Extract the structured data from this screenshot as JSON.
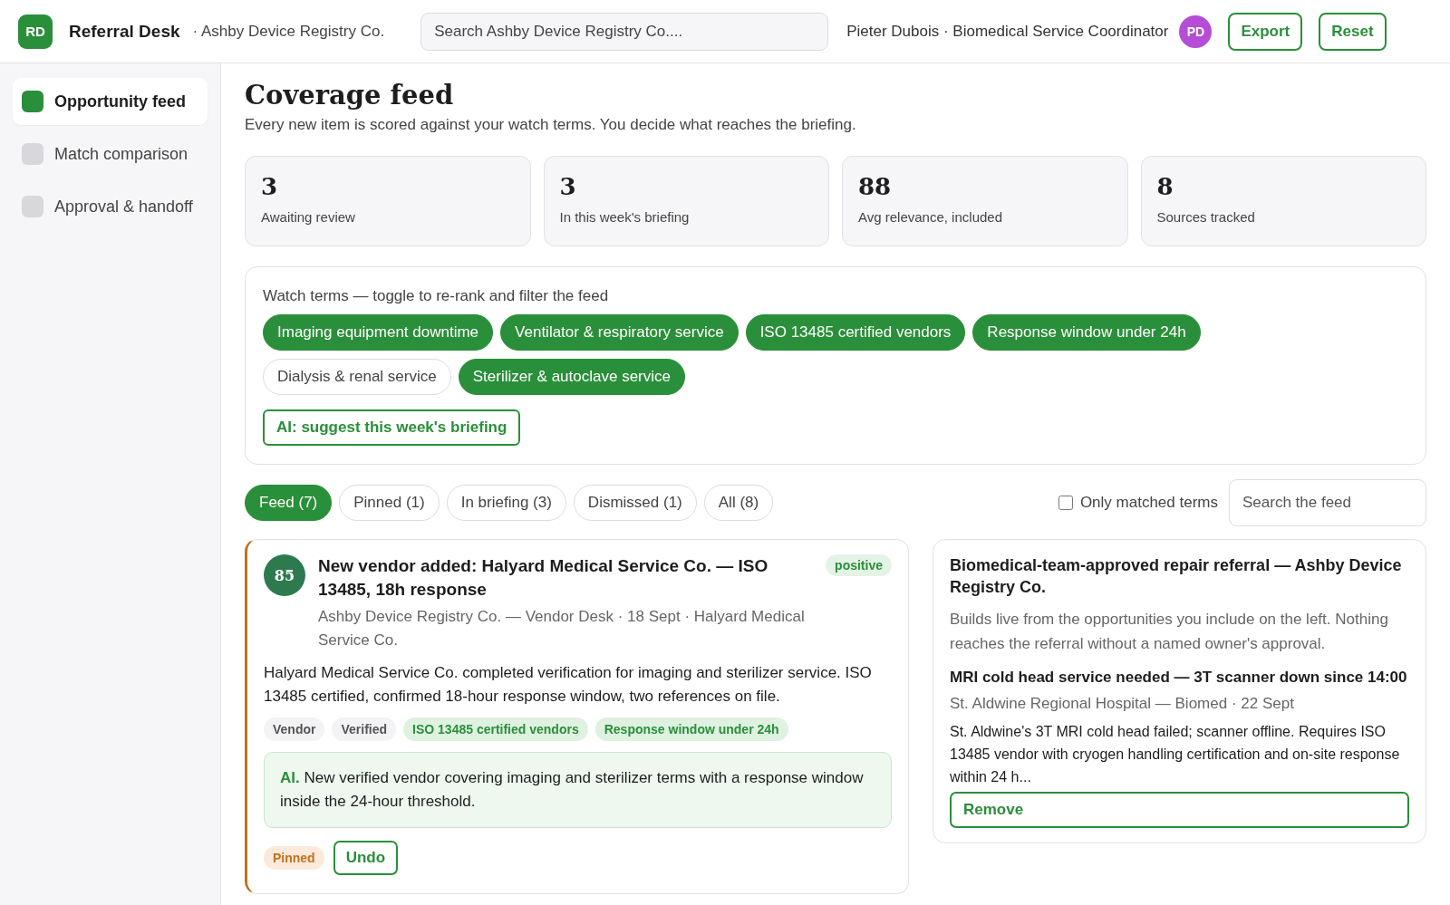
{
  "header": {
    "logo": "RD",
    "app_name": "Referral Desk",
    "org": "· Ashby Device Registry Co.",
    "search": {
      "placeholder": "Search Ashby Device Registry Co...."
    },
    "user": "Pieter Dubois · Biomedical Service Coordinator",
    "avatar": "PD",
    "buttons": [
      "Export",
      "Reset"
    ]
  },
  "sidebar": {
    "items": [
      {
        "label": "Opportunity feed",
        "selected": true
      },
      {
        "label": "Match comparison",
        "selected": false
      },
      {
        "label": "Approval & handoff",
        "selected": false
      }
    ]
  },
  "page": {
    "title": "Coverage feed",
    "subtitle": "Every new item is scored against your watch terms. You decide what reaches the briefing."
  },
  "stats": [
    {
      "value": "3",
      "label": "Awaiting review"
    },
    {
      "value": "3",
      "label": "In this week's briefing"
    },
    {
      "value": "88",
      "label": "Avg relevance, included"
    },
    {
      "value": "8",
      "label": "Sources tracked"
    }
  ],
  "watch_terms": {
    "label": "Watch terms — toggle to re-rank and filter the feed",
    "terms": [
      {
        "label": "Imaging equipment downtime",
        "on": true
      },
      {
        "label": "Ventilator & respiratory service",
        "on": true
      },
      {
        "label": "ISO 13485 certified vendors",
        "on": true
      },
      {
        "label": "Response window under 24h",
        "on": true
      },
      {
        "label": "Dialysis & renal service",
        "on": false
      },
      {
        "label": "Sterilizer & autoclave service",
        "on": true
      }
    ],
    "ai_button": "AI: suggest this week's briefing"
  },
  "filters": {
    "tabs": [
      {
        "label": "Feed (7)",
        "selected": true
      },
      {
        "label": "Pinned (1)",
        "selected": false
      },
      {
        "label": "In briefing (3)",
        "selected": false
      },
      {
        "label": "Dismissed (1)",
        "selected": false
      },
      {
        "label": "All (8)",
        "selected": false
      }
    ],
    "only_matched": {
      "label": "Only matched terms",
      "checked": false
    },
    "search": {
      "placeholder": "Search the feed"
    }
  },
  "feed": [
    {
      "score": "85",
      "title": "New vendor added: Halyard Medical Service Co. — ISO 13485, 18h response",
      "sentiment": "positive",
      "meta": "Ashby Device Registry Co. — Vendor Desk · 18 Sept · Halyard Medical Service Co.",
      "body": "Halyard Medical Service Co. completed verification for imaging and sterilizer service. ISO 13485 certified, confirmed 18-hour response window, two references on file.",
      "tags": [
        {
          "label": "Vendor",
          "kind": "plain"
        },
        {
          "label": "Verified",
          "kind": "plain"
        },
        {
          "label": "ISO 13485 certified vendors",
          "kind": "term"
        },
        {
          "label": "Response window under 24h",
          "kind": "term"
        }
      ],
      "ai_note": "**AI.** New verified vendor covering imaging and sterilizer terms with a response window inside the 24-hour threshold.",
      "pinned": true,
      "status": "Pinned",
      "action": "Undo"
    }
  ],
  "referral": {
    "title": "Biomedical-team-approved repair referral — Ashby Device Registry Co.",
    "description": "Builds live from the opportunities you include on the left. Nothing reaches the referral without a named owner's approval.",
    "items": [
      {
        "title": "MRI cold head service needed — 3T scanner down since 14:00",
        "meta": "St. Aldwine Regional Hospital — Biomed · 22 Sept",
        "body": "St. Aldwine's 3T MRI cold head failed; scanner offline. Requires ISO 13485 vendor with cryogen handling certification and on-site response within 24 h...",
        "action": "Remove"
      }
    ]
  }
}
